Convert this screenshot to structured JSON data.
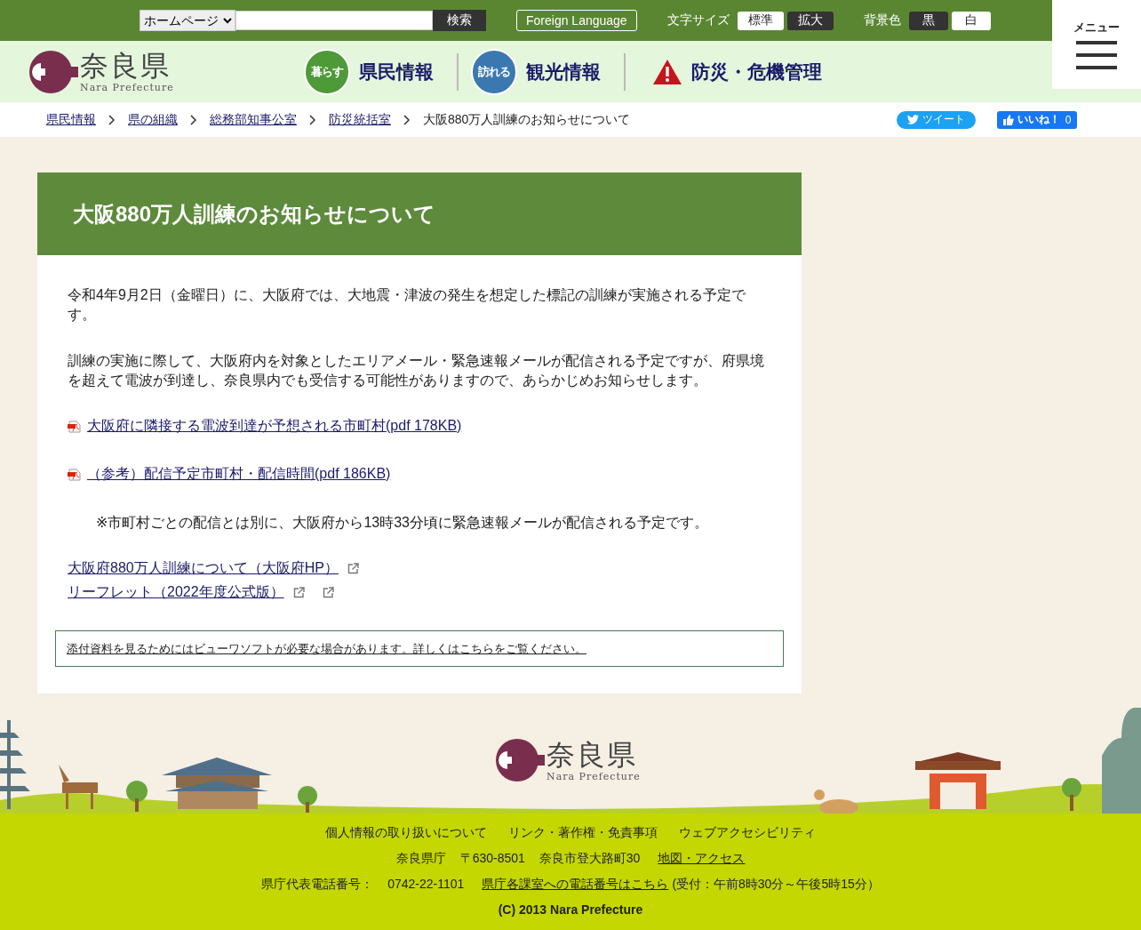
{
  "top_bar": {
    "site_select": "ホームページ",
    "search_button": "検索",
    "foreign_language": "Foreign Language",
    "font_size_label": "文字サイズ",
    "font_size_options": [
      {
        "label": "標準",
        "kind": "light"
      },
      {
        "label": "拡大",
        "kind": "dark"
      }
    ],
    "background_label": "背景色",
    "background_options": [
      {
        "label": "黒",
        "kind": "dark"
      },
      {
        "label": "白",
        "kind": "light"
      }
    ]
  },
  "menu_button": "メニュー",
  "logo": {
    "name": "奈良県",
    "roman": "Nara Prefecture"
  },
  "nav": [
    {
      "badge": "暮らす",
      "label": "県民情報",
      "kind": "circle",
      "color": "#4e9a38"
    },
    {
      "badge": "訪れる",
      "label": "観光情報",
      "kind": "circle",
      "color": "#3b78b0"
    },
    {
      "label": "防災・危機管理",
      "kind": "warning",
      "color": "#c3161c"
    }
  ],
  "breadcrumb": [
    {
      "label": "県民情報",
      "link": true
    },
    {
      "label": "県の組織",
      "link": true
    },
    {
      "label": "総務部知事公室",
      "link": true
    },
    {
      "label": "防災統括室",
      "link": true
    },
    {
      "label": "大阪880万人訓練のお知らせについて",
      "link": false
    }
  ],
  "share": {
    "tweet": "ツイート",
    "like": "いいね！",
    "like_count": "0"
  },
  "article": {
    "title": "大阪880万人訓練のお知らせについて",
    "blocks": [
      {
        "kind": "paragraph",
        "text": "令和4年9月2日（金曜日）に、大阪府では、大地震・津波の発生を想定した標記の訓練が実施される予定です。"
      },
      {
        "kind": "paragraph",
        "text": "訓練の実施に際して、大阪府内を対象としたエリアメール・緊急速報メールが配信される予定ですが、府県境を超えて電波が到達し、奈良県内でも受信する可能性がありますので、あらかじめお知らせします。"
      },
      {
        "kind": "pdf",
        "text": "大阪府に隣接する電波到達が予想される市町村(pdf 178KB)"
      },
      {
        "kind": "pdf",
        "text": "（参考）配信予定市町村・配信時間(pdf 186KB)"
      },
      {
        "kind": "note",
        "text": "※市町村ごとの配信とは別に、大阪府から13時33分頃に緊急速報メールが配信される予定です。"
      }
    ],
    "external_links": [
      {
        "text": "大阪府880万人訓練について（大阪府HP）",
        "extra_icon": false
      },
      {
        "text": "リーフレット（2022年度公式版）",
        "extra_icon": true
      }
    ],
    "viewer_note": "添付資料を見るためにはビューワソフトが必要な場合があります。詳しくはこちらをご覧ください。"
  },
  "footer": {
    "logo_name": "奈良県",
    "logo_roman": "Nara Prefecture",
    "links": [
      "個人情報の取り扱いについて",
      "リンク・著作権・免責事項",
      "ウェブアクセシビリティ"
    ],
    "address": [
      "奈良県庁",
      "〒630-8501",
      "奈良市登大路町30"
    ],
    "map_link": "地図・アクセス",
    "phone_label": "県庁代表電話番号：",
    "phone": "0742-22-1101",
    "phone_link": "県庁各課室への電話番号はこちら",
    "hours": "(受付：午前8時30分～午後5時15分）",
    "copyright": "(C) 2013 Nara Prefecture"
  }
}
